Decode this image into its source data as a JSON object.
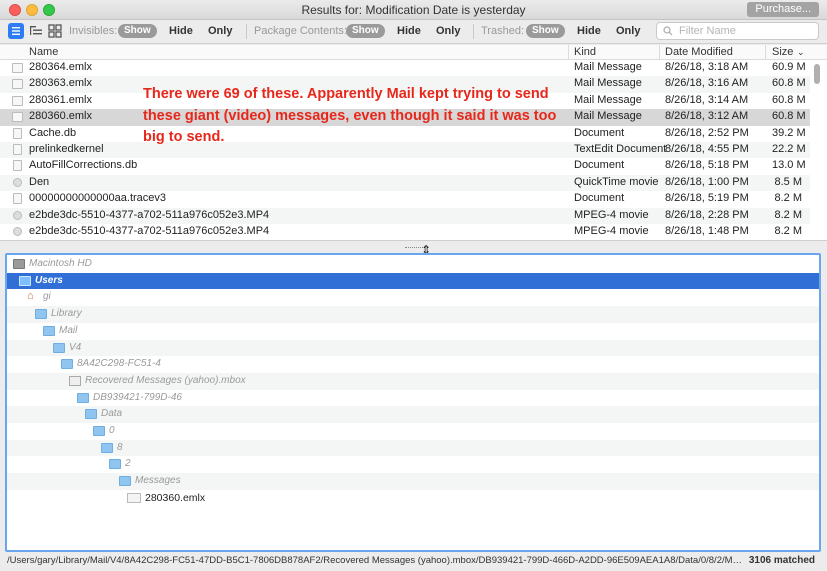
{
  "window": {
    "title": "Results for: Modification Date is yesterday",
    "purchase_label": "Purchase..."
  },
  "toolbar": {
    "invisibles_label": "Invisibles:",
    "package_label": "Package Contents:",
    "trashed_label": "Trashed:",
    "show_label": "Show",
    "hide_label": "Hide",
    "only_label": "Only",
    "filter_placeholder": "Filter Name"
  },
  "table": {
    "columns": {
      "name": "Name",
      "kind": "Kind",
      "date": "Date Modified",
      "size": "Size"
    },
    "rows": [
      {
        "name": "280364.emlx",
        "kind": "Mail Message",
        "date": "8/26/18, 3:18 AM",
        "size": "60.9 M",
        "icon": "mail-icon"
      },
      {
        "name": "280363.emlx",
        "kind": "Mail Message",
        "date": "8/26/18, 3:16 AM",
        "size": "60.8 M",
        "icon": "mail-icon"
      },
      {
        "name": "280361.emlx",
        "kind": "Mail Message",
        "date": "8/26/18, 3:14 AM",
        "size": "60.8 M",
        "icon": "mail-icon"
      },
      {
        "name": "280360.emlx",
        "kind": "Mail Message",
        "date": "8/26/18, 3:12 AM",
        "size": "60.8 M",
        "icon": "mail-icon"
      },
      {
        "name": "Cache.db",
        "kind": "Document",
        "date": "8/26/18, 2:52 PM",
        "size": "39.2 M",
        "icon": "document-icon"
      },
      {
        "name": "prelinkedkernel",
        "kind": "TextEdit Document",
        "date": "8/26/18, 4:55 PM",
        "size": "22.2 M",
        "icon": "document-icon"
      },
      {
        "name": "AutoFillCorrections.db",
        "kind": "Document",
        "date": "8/26/18, 5:18 PM",
        "size": "13.0 M",
        "icon": "document-icon"
      },
      {
        "name": "Den",
        "kind": "QuickTime movie",
        "date": "8/26/18, 1:00 PM",
        "size": "8.5 M",
        "icon": "movie-icon"
      },
      {
        "name": "00000000000000aa.tracev3",
        "kind": "Document",
        "date": "8/26/18, 5:19 PM",
        "size": "8.2 M",
        "icon": "document-icon"
      },
      {
        "name": "e2bde3dc-5510-4377-a702-511a976c052e3.MP4",
        "kind": "MPEG-4 movie",
        "date": "8/26/18, 2:28 PM",
        "size": "8.2 M",
        "icon": "movie-icon"
      },
      {
        "name": "e2bde3dc-5510-4377-a702-511a976c052e3.MP4",
        "kind": "MPEG-4 movie",
        "date": "8/26/18, 1:48 PM",
        "size": "8.2 M",
        "icon": "movie-icon"
      }
    ]
  },
  "annotation": "There were 69 of these. Apparently Mail kept trying to send these giant (video) messages, even though it said it was too big to send.",
  "outline": [
    {
      "label": "Macintosh HD",
      "icon": "disk-icon"
    },
    {
      "label": "Users",
      "icon": "folder-icon"
    },
    {
      "label": "gi",
      "icon": "home-icon"
    },
    {
      "label": "Library",
      "icon": "folder-icon"
    },
    {
      "label": "Mail",
      "icon": "folder-icon"
    },
    {
      "label": "V4",
      "icon": "folder-icon"
    },
    {
      "label": "8A42C298-FC51-4",
      "icon": "folder-icon"
    },
    {
      "label": "Recovered Messages (yahoo).mbox",
      "icon": "mbox-icon"
    },
    {
      "label": "DB939421-799D-46",
      "icon": "folder-icon"
    },
    {
      "label": "Data",
      "icon": "folder-icon"
    },
    {
      "label": "0",
      "icon": "folder-icon"
    },
    {
      "label": "8",
      "icon": "folder-icon"
    },
    {
      "label": "2",
      "icon": "folder-icon"
    },
    {
      "label": "Messages",
      "icon": "folder-icon"
    },
    {
      "label": "280360.emlx",
      "icon": "mail-file-icon"
    }
  ],
  "status": {
    "path": "/Users/gary/Library/Mail/V4/8A42C298-FC51-47DD-B5C1-7806DB878AF2/Recovered Messages (yahoo).mbox/DB939421-799D-466D-A2DD-96E509AEA1A8/Data/0/8/2/Messages...",
    "count": "3106 matched"
  },
  "colors": {
    "selection_blue": "#2f6fd6",
    "annotation_red": "#e8271b",
    "show_pill": "#9a9a9a"
  }
}
